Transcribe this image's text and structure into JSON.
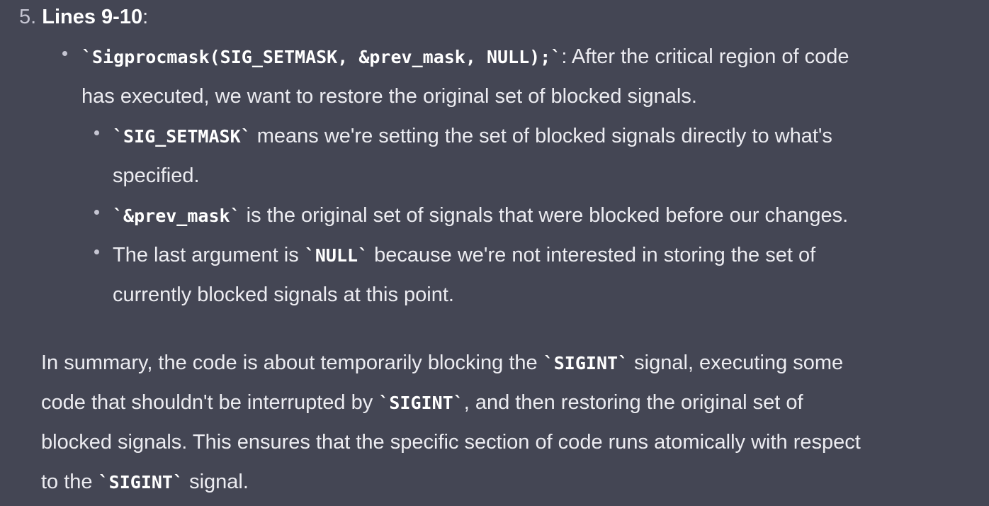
{
  "item": {
    "number": "5.",
    "title": "Lines 9-10",
    "colon": ":"
  },
  "bullet1": {
    "code": "`Sigprocmask(SIG_SETMASK, &prev_mask, NULL);`",
    "text_a": ": After the critical region of code",
    "text_b": "has executed, we want to restore the original set of blocked signals."
  },
  "sub1": {
    "code": "`SIG_SETMASK`",
    "text_a": " means we're setting the set of blocked signals directly to what's",
    "text_b": "specified."
  },
  "sub2": {
    "code": "`&prev_mask`",
    "text_a": " is the original set of signals that were blocked before our changes."
  },
  "sub3": {
    "text_a": "The last argument is ",
    "code": "`NULL`",
    "text_b": " because we're not interested in storing the set of",
    "text_c": "currently blocked signals at this point."
  },
  "summary": {
    "l1_a": "In summary, the code is about temporarily blocking the ",
    "l1_code": "`SIGINT`",
    "l1_b": " signal, executing some",
    "l2_a": "code that shouldn't be interrupted by ",
    "l2_code": "`SIGINT`",
    "l2_b": ", and then restoring the original set of",
    "l3": "blocked signals. This ensures that the specific section of code runs atomically with respect",
    "l4_a": "to the ",
    "l4_code": "`SIGINT`",
    "l4_b": " signal."
  }
}
